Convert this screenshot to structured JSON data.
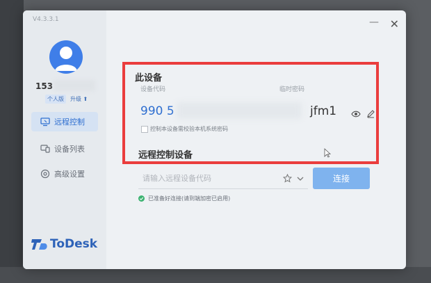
{
  "app": {
    "version": "V4.3.3.1",
    "logo_text": "ToDesk"
  },
  "user": {
    "name_partial": "153",
    "badge_personal": "个人版",
    "badge_upgrade": "升级"
  },
  "sidebar": {
    "items": [
      {
        "label": "远程控制",
        "icon": "monitor-icon",
        "active": true
      },
      {
        "label": "设备列表",
        "icon": "device-list-icon",
        "active": false
      },
      {
        "label": "高级设置",
        "icon": "settings-icon",
        "active": false
      }
    ]
  },
  "this_device": {
    "title": "此设备",
    "code_label": "设备代码",
    "code_value": "990 5",
    "temp_password_label": "临时密码",
    "temp_password_value": "jfm1",
    "verify_checkbox_label": "控制本设备需校验本机系统密码"
  },
  "remote": {
    "title": "远程控制设备",
    "input_placeholder": "请输入远程设备代码",
    "connect_label": "连接",
    "status_text": "已准备好连接(请到端加密已启用)"
  },
  "colors": {
    "accent": "#2f6fd0",
    "highlight_box": "#ea3d3d",
    "connect_button": "#7fb3ee"
  }
}
